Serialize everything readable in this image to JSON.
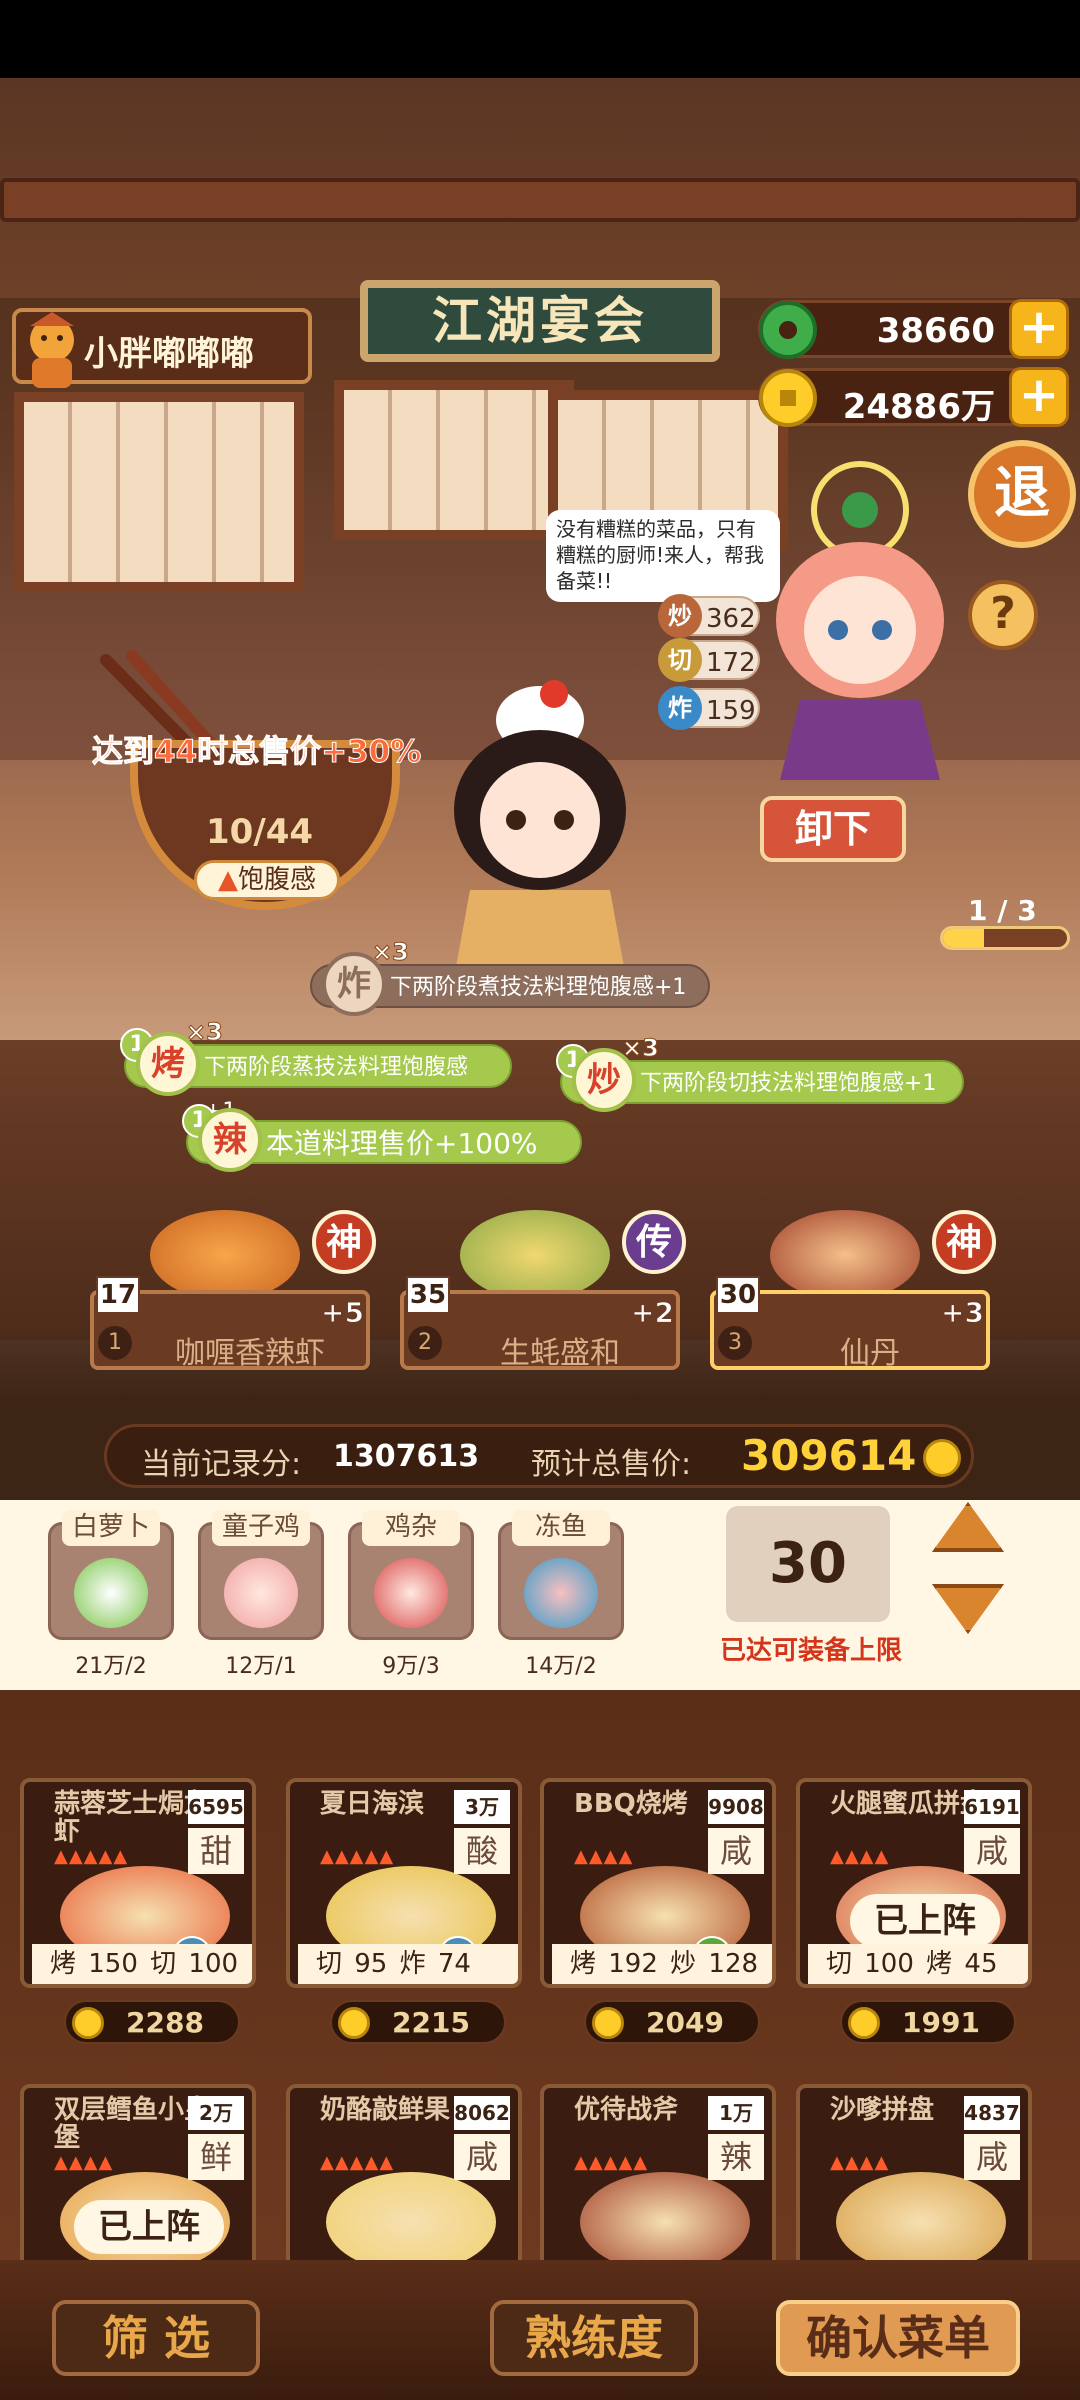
{
  "header": {
    "player_name": "小胖嘟嘟嘟",
    "title_sign": "江湖宴会",
    "jade": "38660",
    "coins": "24886万",
    "plus": "+",
    "exit_label": "退",
    "help_label": "?"
  },
  "chef": {
    "speech": "没有糟糕的菜品，只有糟糕的厨师!来人，帮我备菜!!",
    "skills": [
      {
        "icon": "炒",
        "value": "362"
      },
      {
        "icon": "切",
        "value": "172"
      },
      {
        "icon": "炸",
        "value": "159"
      }
    ],
    "unload_label": "卸下"
  },
  "pager": {
    "text": "1 / 3",
    "fraction": 0.33
  },
  "bowl": {
    "goal": "达到44时总售价+30%",
    "count": "10/44",
    "label": "饱腹感"
  },
  "buffs": [
    {
      "num": "",
      "icon": "炸",
      "mult": "×3",
      "text": "下两阶段煮技法料理饱腹感+1"
    },
    {
      "num": "1",
      "icon": "烤",
      "mult": "×3",
      "text": "下两阶段蒸技法料理饱腹感+1"
    },
    {
      "num": "1",
      "icon": "炒",
      "mult": "×3",
      "text": "下两阶段切技法料理饱腹感+1"
    },
    {
      "num": "1",
      "icon": "辣",
      "mult": "",
      "text": "本道料理售价+100%"
    }
  ],
  "equipped": [
    {
      "count": "17",
      "index": "1",
      "name": "咖喱香辣虾",
      "bonus": "+5",
      "tier": "神"
    },
    {
      "count": "35",
      "index": "2",
      "name": "生蚝盛和",
      "bonus": "+2",
      "tier": "传"
    },
    {
      "count": "30",
      "index": "3",
      "name": "仙丹",
      "bonus": "+3",
      "tier": "神"
    }
  ],
  "score": {
    "current_label": "当前记录分:",
    "current_value": "1307613",
    "total_label": "预计总售价:",
    "total_value": "309614"
  },
  "ingredients": [
    {
      "name": "白萝卜",
      "amount": "21万/2"
    },
    {
      "name": "童子鸡",
      "amount": "12万/1"
    },
    {
      "name": "鸡杂",
      "amount": "9万/3"
    },
    {
      "name": "冻鱼",
      "amount": "14万/2"
    }
  ],
  "capacity": {
    "value": "30",
    "note": "已达可装备上限"
  },
  "recipes": [
    {
      "name": "蒜蓉芝士焗龙虾",
      "hearts": 5,
      "num": "6595",
      "flavor": "甜",
      "badge": "可",
      "status": "",
      "stats": "烤 150  切 100",
      "price": "2288"
    },
    {
      "name": "夏日海滨",
      "hearts": 5,
      "num": "3万",
      "flavor": "酸",
      "badge": "可",
      "status": "",
      "stats": "切 95  炸 74",
      "price": "2215"
    },
    {
      "name": "BBQ烧烤",
      "hearts": 4,
      "num": "9908",
      "flavor": "咸",
      "badge": "优",
      "status": "",
      "stats": "烤 192  炒 128",
      "price": "2049"
    },
    {
      "name": "火腿蜜瓜拼盘",
      "hearts": 4,
      "num": "6191",
      "flavor": "咸",
      "badge": "可",
      "status": "已上阵",
      "stats": "切 100  烤 45",
      "price": "1991"
    },
    {
      "name": "双层鳕鱼小皇堡",
      "hearts": 4,
      "num": "2万",
      "flavor": "鲜",
      "badge": "",
      "status": "已上阵",
      "stats": "",
      "price": ""
    },
    {
      "name": "奶酪敲鲜果",
      "hearts": 5,
      "num": "8062",
      "flavor": "咸",
      "badge": "",
      "status": "",
      "stats": "",
      "price": ""
    },
    {
      "name": "优待战斧",
      "hearts": 5,
      "num": "1万",
      "flavor": "辣",
      "badge": "",
      "status": "",
      "stats": "",
      "price": ""
    },
    {
      "name": "沙嗲拼盘",
      "hearts": 4,
      "num": "4837",
      "flavor": "咸",
      "badge": "",
      "status": "",
      "stats": "",
      "price": ""
    }
  ],
  "buttons": {
    "filter": "筛 选",
    "proficiency": "熟练度",
    "confirm": "确认菜单"
  },
  "colors": {
    "accent": "#ffd23a",
    "warning": "#d4361c",
    "buff_green": "#a4c94c"
  }
}
